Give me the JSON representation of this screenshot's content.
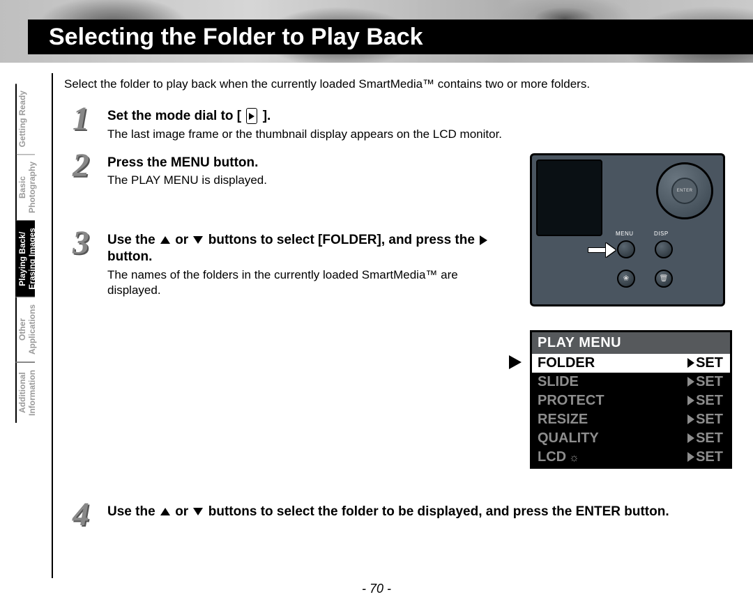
{
  "title": "Selecting the Folder to Play Back",
  "intro": "Select the folder to play back when the currently loaded SmartMedia™ contains two or more folders.",
  "side_tabs": [
    {
      "label": "Getting Ready",
      "active": false
    },
    {
      "label": "Basic\nPhotography",
      "active": false
    },
    {
      "label": "Playing Back/\nErasing Images",
      "active": true
    },
    {
      "label": "Other\nApplications",
      "active": false
    },
    {
      "label": "Additional\nInformation",
      "active": false
    }
  ],
  "steps": {
    "s1": {
      "num": "1",
      "title_pre": "Set the mode dial to [ ",
      "title_post": " ].",
      "desc": "The last image frame or the thumbnail display appears on the LCD monitor."
    },
    "s2": {
      "num": "2",
      "title": "Press the MENU button.",
      "desc": "The PLAY MENU is displayed."
    },
    "s3": {
      "num": "3",
      "title_a": "Use the ",
      "title_b": " or ",
      "title_c": " buttons to select [FOLDER], and press the ",
      "title_d": " button.",
      "desc": "The names of the folders in the currently loaded SmartMedia™ are displayed."
    },
    "s4": {
      "num": "4",
      "title_a": "Use the ",
      "title_b": " or ",
      "title_c": " buttons to select the folder to be displayed, and press the ENTER button."
    }
  },
  "camera": {
    "enter": "ENTER",
    "menu": "MENU",
    "disp": "DISP"
  },
  "play_menu": {
    "header": "PLAY MENU",
    "set": "SET",
    "rows": [
      {
        "label": "FOLDER",
        "selected": true,
        "lcd": false
      },
      {
        "label": "SLIDE",
        "selected": false,
        "lcd": false
      },
      {
        "label": "PROTECT",
        "selected": false,
        "lcd": false
      },
      {
        "label": "RESIZE",
        "selected": false,
        "lcd": false
      },
      {
        "label": "QUALITY",
        "selected": false,
        "lcd": false
      },
      {
        "label": "LCD",
        "selected": false,
        "lcd": true
      }
    ]
  },
  "page_number": "- 70 -"
}
